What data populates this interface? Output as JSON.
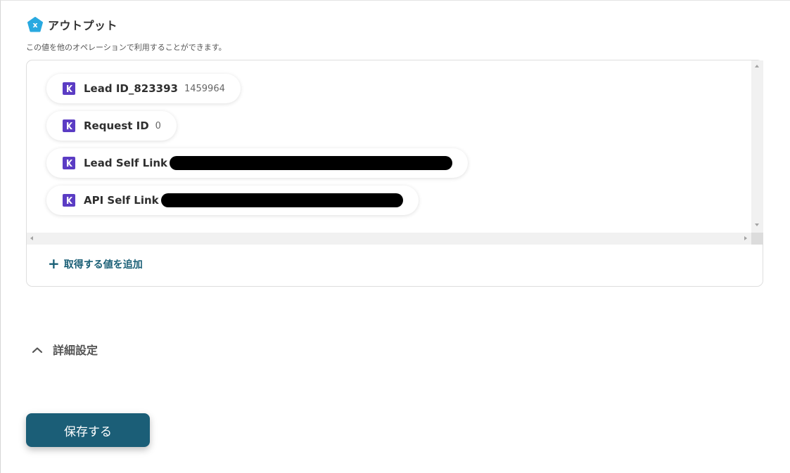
{
  "output_section": {
    "badge_letter": "x",
    "title": "アウトプット",
    "description": "この値を他のオペレーションで利用することができます。"
  },
  "output_items": [
    {
      "icon": "k-app-icon",
      "label": "Lead ID_823393",
      "value": "1459964",
      "redacted": false
    },
    {
      "icon": "k-app-icon",
      "label": "Request ID",
      "value": "0",
      "redacted": false
    },
    {
      "icon": "k-app-icon",
      "label": "Lead Self Link",
      "value": "",
      "redacted": true
    },
    {
      "icon": "k-app-icon",
      "label": "API Self Link",
      "value": "",
      "redacted": true
    }
  ],
  "add_value": {
    "icon": "plus-icon",
    "label": "取得する値を追加"
  },
  "detail_settings": {
    "icon": "chevron-up-icon",
    "label": "詳細設定"
  },
  "save_button": {
    "label": "保存する"
  },
  "colors": {
    "accent": "#1b5e77",
    "link": "#1a5f76",
    "badge": "#29a9e0",
    "app_icon": "#5b3cc4",
    "redaction": "#000000"
  }
}
